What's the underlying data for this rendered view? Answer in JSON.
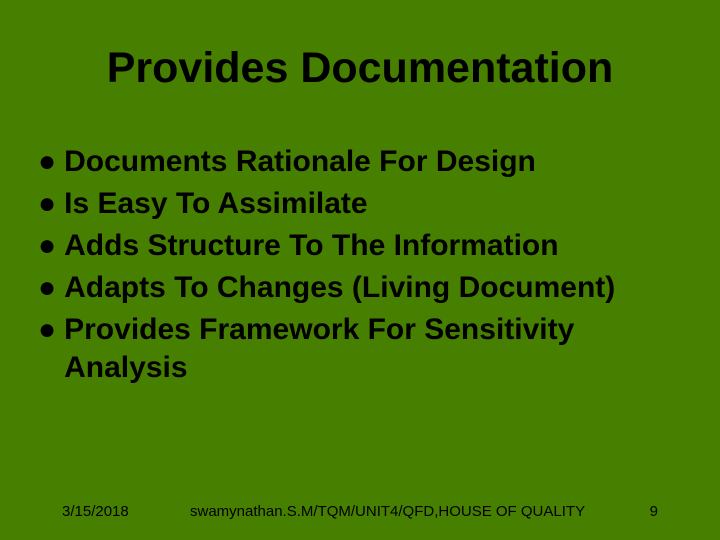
{
  "title": "Provides Documentation",
  "bullets": [
    "Documents Rationale For Design",
    "Is Easy To Assimilate",
    "Adds Structure To The Information",
    "Adapts To Changes (Living Document)",
    "Provides Framework For Sensitivity Analysis"
  ],
  "footer": {
    "date": "3/15/2018",
    "author": "swamynathan.S.M/TQM/UNIT4/QFD,HOUSE OF QUALITY",
    "page": "9"
  }
}
